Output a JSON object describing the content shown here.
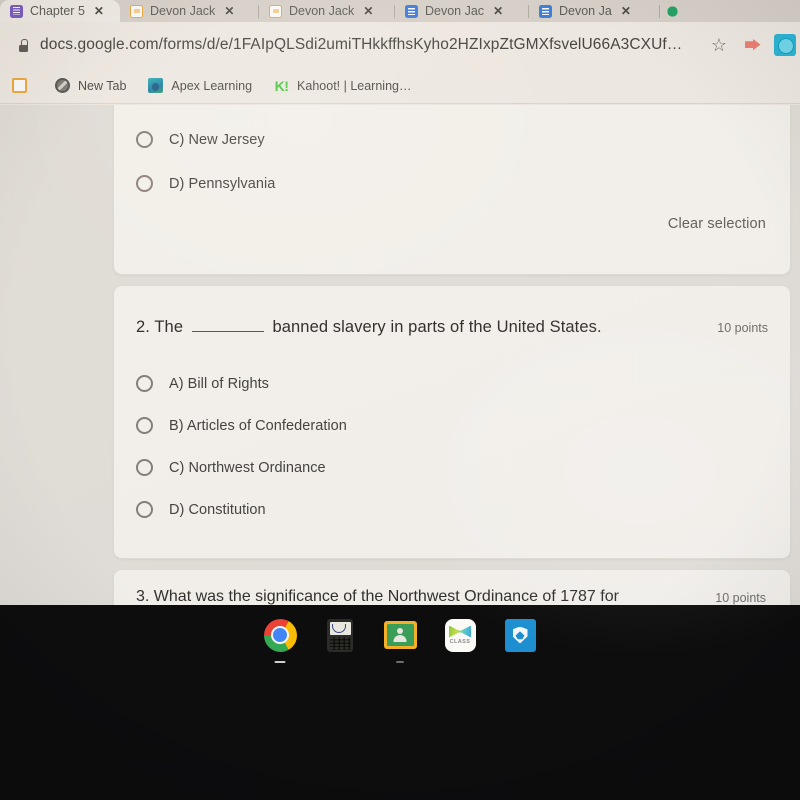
{
  "browser": {
    "tabs": [
      {
        "label": "Chapter 5",
        "favicon": "docs-icon",
        "close": "✕",
        "active": true
      },
      {
        "label": "Devon Jack",
        "favicon": "slides-icon",
        "close": "✕",
        "active": false
      },
      {
        "label": "Devon Jack",
        "favicon": "slides-icon",
        "close": "✕",
        "active": false
      },
      {
        "label": "Devon Jac",
        "favicon": "forms-icon",
        "close": "✕",
        "active": false
      },
      {
        "label": "Devon Ja",
        "favicon": "forms-icon",
        "close": "✕",
        "active": false
      }
    ],
    "address_bar": {
      "lock_icon": "lock-icon",
      "url": "docs.google.com/forms/d/e/1FAIpQLSdi2umiTHkkffhsKyho2HZIxpZtGMXfsvelU66A3CXUf…",
      "star_icon": "☆",
      "extension_icon": "extension-icon",
      "profile_icon": "profile-avatar-icon"
    },
    "bookmarks": [
      {
        "label": "",
        "icon": "slides-icon"
      },
      {
        "label": "New Tab",
        "icon": "globe-icon"
      },
      {
        "label": "Apex Learning",
        "icon": "apex-learning-icon"
      },
      {
        "label": "Kahoot! | Learning…",
        "icon": "kahoot-icon"
      }
    ]
  },
  "form": {
    "question1": {
      "options": [
        {
          "label": "C) New Jersey"
        },
        {
          "label": "D) Pennsylvania"
        }
      ],
      "clear_selection": "Clear selection"
    },
    "question2": {
      "number": "2.",
      "text_before": "The",
      "text_after": "banned slavery in parts of the United States.",
      "points": "10 points",
      "options": [
        {
          "label": "A) Bill of Rights"
        },
        {
          "label": "B) Articles of Confederation"
        },
        {
          "label": "C) Northwest Ordinance"
        },
        {
          "label": "D) Constitution"
        }
      ]
    },
    "question3": {
      "text": "3. What was the significance of the Northwest Ordinance of 1787 for",
      "points": "10 points"
    }
  },
  "shelf": {
    "apps": [
      {
        "name": "Chrome",
        "icon": "chrome-icon"
      },
      {
        "name": "Graphing Calculator",
        "icon": "calculator-icon"
      },
      {
        "name": "Google Classroom",
        "icon": "google-classroom-icon"
      },
      {
        "name": "CLASS",
        "icon": "class-app-icon",
        "label": "CLASS"
      },
      {
        "name": "Security Shield",
        "icon": "shield-icon"
      }
    ]
  },
  "colors": {
    "browser_chrome": "#f1ece5",
    "tab_strip": "#d9d3cb",
    "form_background": "#e4e0da",
    "card_background": "#f7f4ef",
    "shelf": "#0d0d0e",
    "chrome_blue": "#4285f4"
  }
}
